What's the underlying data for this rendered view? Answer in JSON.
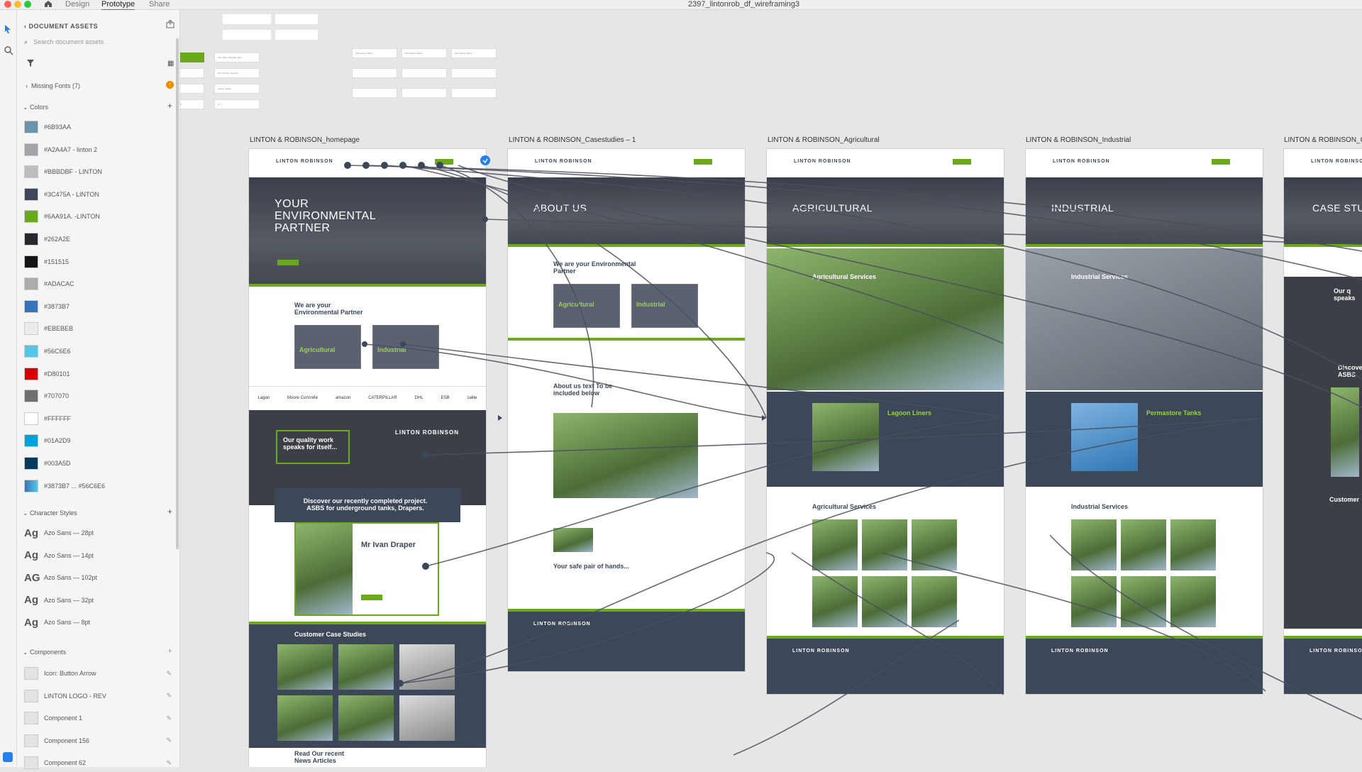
{
  "app": {
    "tabs": [
      "Design",
      "Prototype",
      "Share"
    ],
    "active_tab": "Prototype",
    "document_title": "2397_lintonrob_df_wireframing3"
  },
  "assets_panel": {
    "title": "DOCUMENT ASSETS",
    "search_placeholder": "Search document assets",
    "missing_fonts": "Missing Fonts (7)",
    "sections": {
      "colors": "Colors",
      "character_styles": "Character Styles",
      "components": "Components"
    },
    "colors": [
      {
        "label": "#6B93AA",
        "hex": "#6B93AA"
      },
      {
        "label": "#A2A4A7 - linton 2",
        "hex": "#A2A4A7"
      },
      {
        "label": "#BBBDBF - LINTON",
        "hex": "#BBBDBF"
      },
      {
        "label": "#3C475A - LINTON",
        "hex": "#3C475A"
      },
      {
        "label": "#6AA91A. -LINTON",
        "hex": "#6AA91A"
      },
      {
        "label": "#262A2E",
        "hex": "#262A2E"
      },
      {
        "label": "#151515",
        "hex": "#151515"
      },
      {
        "label": "#ADACAC",
        "hex": "#ADACAC"
      },
      {
        "label": "#3873B7",
        "hex": "#3873B7"
      },
      {
        "label": "#EBEBEB",
        "hex": "#EBEBEB"
      },
      {
        "label": "#56C6E6",
        "hex": "#56C6E6"
      },
      {
        "label": "#D80101",
        "hex": "#D80101"
      },
      {
        "label": "#707070",
        "hex": "#707070"
      },
      {
        "label": "#FFFFFF",
        "hex": "#FFFFFF"
      },
      {
        "label": "#01A2D9",
        "hex": "#01A2D9"
      },
      {
        "label": "#003A5D",
        "hex": "#003A5D"
      },
      {
        "label": "#3873B7 ... #56C6E6",
        "hex": "#3873B7",
        "hex2": "#56C6E6"
      }
    ],
    "character_styles": [
      {
        "sample": "Ag",
        "label": "Azo Sans — 28pt"
      },
      {
        "sample": "Ag",
        "label": "Azo Sans — 14pt"
      },
      {
        "sample": "AG",
        "label": "Azo Sans — 102pt"
      },
      {
        "sample": "Ag",
        "label": "Azo Sans — 32pt"
      },
      {
        "sample": "Ag",
        "label": "Azo Sans — 8pt"
      }
    ],
    "components": [
      {
        "label": "Icon: Button Arrow"
      },
      {
        "label": "LINTON LOGO - REV"
      },
      {
        "label": "Component 1"
      },
      {
        "label": "Component 156"
      },
      {
        "label": "Component 62"
      }
    ]
  },
  "artboards": [
    {
      "label": "LINTON & ROBINSON_homepage",
      "hero_title": "YOUR ENVIRONMENTAL PARTNER",
      "partner_heading": "We are your Environmental Partner",
      "cards": [
        "Agricultural",
        "Industrial"
      ],
      "logos": [
        "Lagan",
        "Moore Concrete",
        "amazon",
        "CATERPILLAR",
        "DHL",
        "ESB",
        "calite"
      ],
      "quality_heading": "Our quality work speaks for itself...",
      "discover_heading": "Discover our recently completed project. ASBS for underground tanks, Drapers.",
      "person_name": "Mr Ivan Draper",
      "case_studies_heading": "Customer Case Studies",
      "articles_heading": "Read Our recent News Articles"
    },
    {
      "label": "LINTON & ROBINSON_Casestudies – 1",
      "hero_title": "ABOUT US",
      "partner_heading": "We are your Environmental Partner",
      "cards": [
        "Agricultural",
        "Industrial"
      ],
      "about_heading": "About us text To be included below",
      "hands_heading": "Your safe pair of hands..."
    },
    {
      "label": "LINTON & ROBINSON_Agricultural",
      "hero_title": "AGRICULTURAL",
      "services_heading": "Agricultural Services",
      "feature": "Lagoon Liners",
      "services_grid_heading": "Agricultural Services"
    },
    {
      "label": "LINTON & ROBINSON_Industrial",
      "hero_title": "INDUSTRIAL",
      "services_heading": "Industrial Services",
      "feature": "Permastore Tanks",
      "services_grid_heading": "Industrial Services"
    },
    {
      "label": "LINTON & ROBINSON_Ca",
      "hero_title": "CASE STUD",
      "side_heading": "Our q speaks",
      "discover": "Discove ASBS",
      "customer": "Customer"
    }
  ],
  "logo_text": "LINTON ROBINSON",
  "floating_buttons_row1": [
    "Permastore Tanks",
    "Permastore Tanks",
    "Permastore Tanks"
  ],
  "floating_menu": [
    "Permastore Tanks",
    "Fire Water Sprinkler Tank",
    "GRP Roof",
    "Tank Survey Services",
    "Hex Floating Cover",
    "Lagoon Quilts",
    "Fine Bubble Diffuser",
    "N. 2"
  ],
  "colors": {
    "accent": "#6AA91A",
    "navy": "#3C475A",
    "selection": "#2680EB"
  }
}
